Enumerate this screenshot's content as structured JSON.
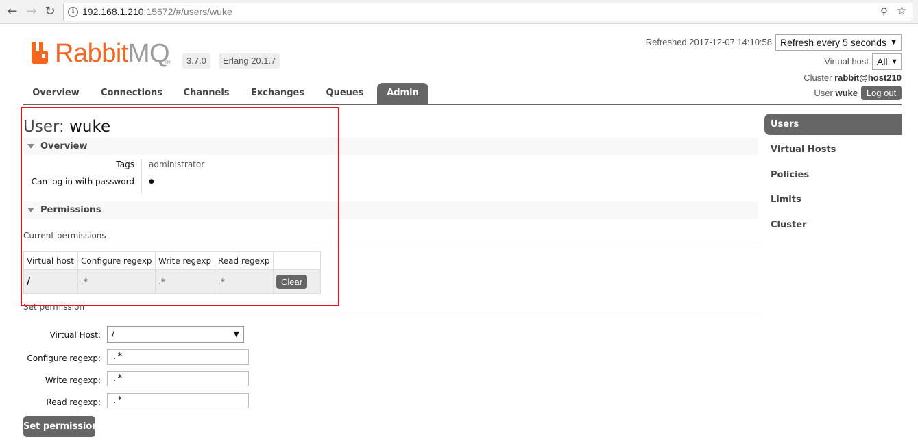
{
  "browser": {
    "back_glyph": "←",
    "forward_glyph": "→",
    "reload_glyph": "↻",
    "info_glyph": "i",
    "url_host": "192.168.1.210",
    "url_rest": ":15672/#/users/wuke",
    "key_glyph": "⚲",
    "star_glyph": "☆"
  },
  "header": {
    "logo_rabbit": "Rabbit",
    "logo_mq": "MQ",
    "logo_tm": "TM",
    "version": "3.7.0",
    "erlang": "Erlang 20.1.7",
    "refreshed_label": "Refreshed 2017-12-07 14:10:58",
    "refresh_select": "Refresh every 5 seconds",
    "vhost_label": "Virtual host",
    "vhost_select": "All",
    "cluster_label": "Cluster",
    "cluster_name": "rabbit@host210",
    "user_label": "User",
    "user_name": "wuke",
    "logout": "Log out",
    "select_arrow": "▼"
  },
  "tabs": [
    "Overview",
    "Connections",
    "Channels",
    "Exchanges",
    "Queues",
    "Admin"
  ],
  "page": {
    "title_prefix": "User:",
    "title_user": "wuke",
    "overview_section": "Overview",
    "tags_label": "Tags",
    "tags_value": "administrator",
    "password_label": "Can log in with password",
    "password_value": "●",
    "permissions_section": "Permissions",
    "current_permissions": "Current permissions",
    "table_headers": [
      "Virtual host",
      "Configure regexp",
      "Write regexp",
      "Read regexp"
    ],
    "table_row": {
      "vhost": "/",
      "configure": ".*",
      "write": ".*",
      "read": ".*",
      "clear": "Clear"
    },
    "set_permission_heading": "Set permission",
    "form": {
      "vhost_label": "Virtual Host:",
      "vhost_value": "/",
      "configure_label": "Configure regexp:",
      "configure_value": ".*",
      "write_label": "Write regexp:",
      "write_value": ".*",
      "read_label": "Read regexp:",
      "read_value": ".*"
    },
    "set_permission_button": "Set permission"
  },
  "sidebar": [
    "Users",
    "Virtual Hosts",
    "Policies",
    "Limits",
    "Cluster"
  ],
  "colors": {
    "brand_orange": "#f26722",
    "active_tab": "#666666",
    "annotation_red": "#e8121c"
  }
}
